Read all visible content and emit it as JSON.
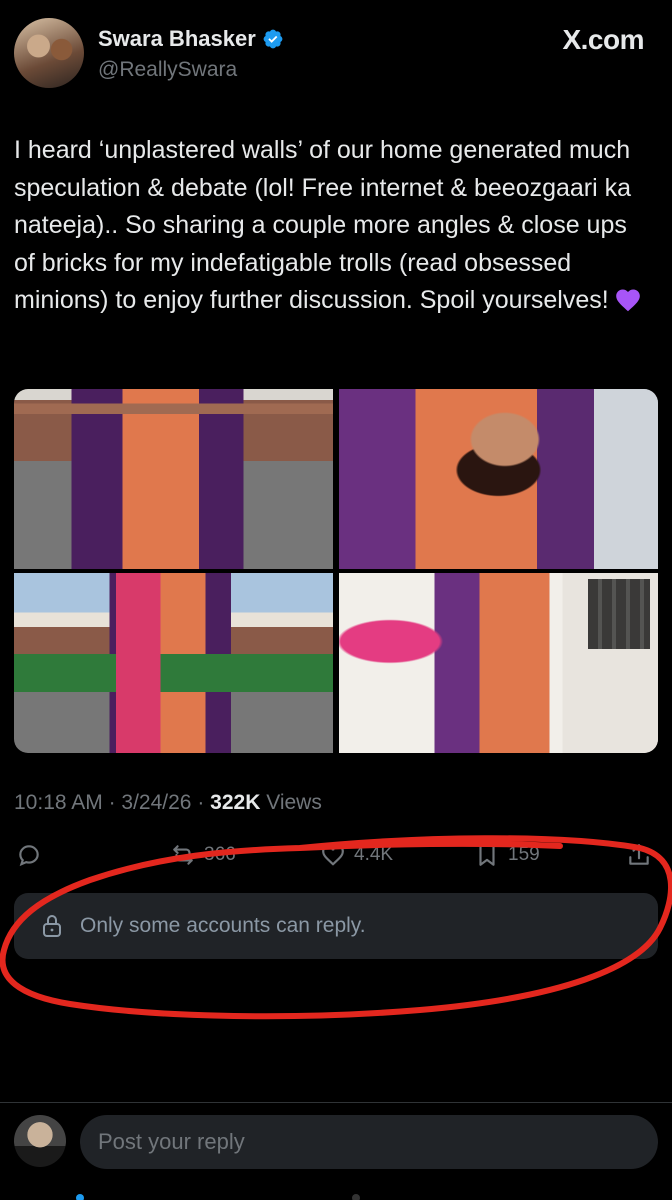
{
  "author": {
    "display_name": "Swara Bhasker",
    "handle": "@ReallySwara",
    "verified": true
  },
  "brand": "X.com",
  "tweet": {
    "text": "I heard ‘unplastered walls’ of our home generated much speculation & debate (lol! Free internet & beeozgaari ka nateeja).. So sharing a couple more angles & close ups of bricks for my indefatigable trolls (read obsessed minions) to enjoy further discussion. Spoil yourselves!",
    "emoji_icon": "purple-heart-icon",
    "images": [
      "photo",
      "photo",
      "photo",
      "photo"
    ]
  },
  "meta": {
    "time": "10:18 AM",
    "separator": " · ",
    "date": "3/24/26",
    "views_count": "322K",
    "views_label": " Views"
  },
  "actions": {
    "reply_icon": "reply-icon",
    "retweet_icon": "retweet-icon",
    "retweets": "366",
    "like_icon": "heart-icon",
    "likes": "4.4K",
    "bookmark_icon": "bookmark-icon",
    "bookmarks": "159",
    "share_icon": "share-icon"
  },
  "reply_restriction": {
    "icon": "lock-icon",
    "text": "Only some accounts can reply."
  },
  "composer": {
    "placeholder": "Post your reply"
  },
  "colors": {
    "background": "#000000",
    "text_primary": "#e7e9ea",
    "text_secondary": "#71767b",
    "verified_blue": "#1d9bf0",
    "annotation_red": "#e3271e",
    "card_bg": "#202327"
  }
}
